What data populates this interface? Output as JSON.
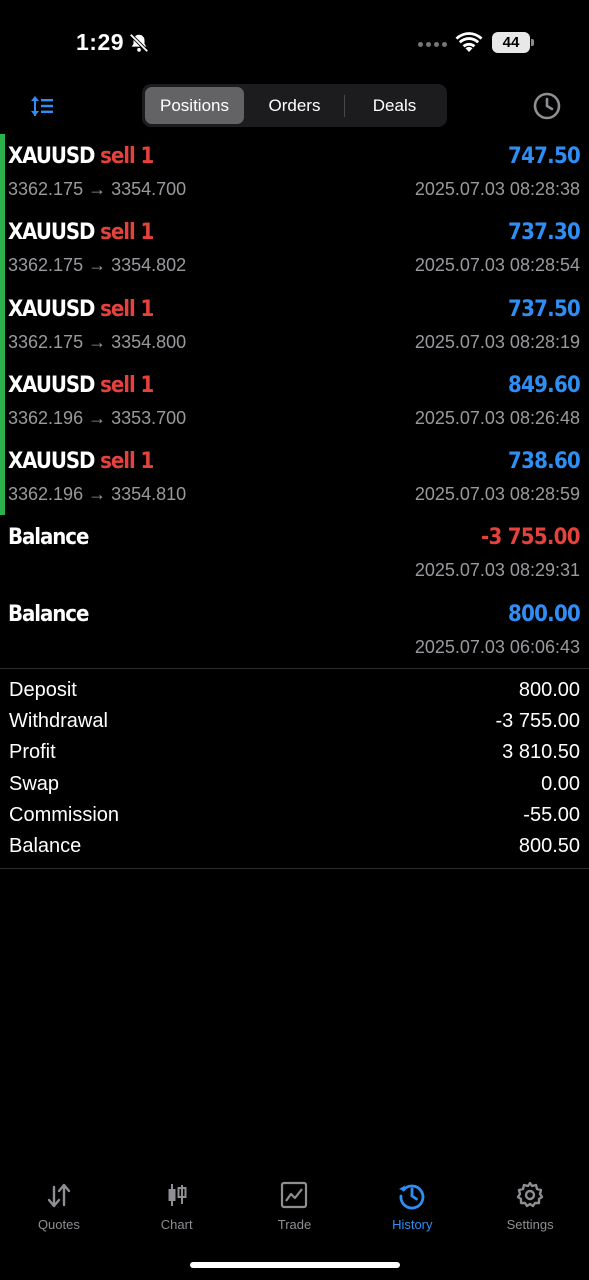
{
  "status": {
    "time": "1:29",
    "battery": "44"
  },
  "header": {
    "segments": [
      "Positions",
      "Orders",
      "Deals"
    ],
    "active_segment": "Positions"
  },
  "deals": [
    {
      "symbol": "XAUUSD",
      "side": "sell 1",
      "profit": "747.50",
      "open": "3362.175",
      "close": "3354.700",
      "time": "2025.07.03 08:28:38"
    },
    {
      "symbol": "XAUUSD",
      "side": "sell 1",
      "profit": "737.30",
      "open": "3362.175",
      "close": "3354.802",
      "time": "2025.07.03 08:28:54"
    },
    {
      "symbol": "XAUUSD",
      "side": "sell 1",
      "profit": "737.50",
      "open": "3362.175",
      "close": "3354.800",
      "time": "2025.07.03 08:28:19"
    },
    {
      "symbol": "XAUUSD",
      "side": "sell 1",
      "profit": "849.60",
      "open": "3362.196",
      "close": "3353.700",
      "time": "2025.07.03 08:26:48"
    },
    {
      "symbol": "XAUUSD",
      "side": "sell 1",
      "profit": "738.60",
      "open": "3362.196",
      "close": "3354.810",
      "time": "2025.07.03 08:28:59"
    }
  ],
  "balances": [
    {
      "label": "Balance",
      "amount": "-3 755.00",
      "time": "2025.07.03 08:29:31"
    },
    {
      "label": "Balance",
      "amount": "800.00",
      "time": "2025.07.03 06:06:43"
    }
  ],
  "summary": [
    {
      "label": "Deposit",
      "value": "800.00"
    },
    {
      "label": "Withdrawal",
      "value": "-3 755.00"
    },
    {
      "label": "Profit",
      "value": "3 810.50"
    },
    {
      "label": "Swap",
      "value": "0.00"
    },
    {
      "label": "Commission",
      "value": "-55.00"
    },
    {
      "label": "Balance",
      "value": "800.50"
    }
  ],
  "tabs": [
    {
      "label": "Quotes",
      "icon": "quotes-arrows-icon"
    },
    {
      "label": "Chart",
      "icon": "candlestick-icon"
    },
    {
      "label": "Trade",
      "icon": "trade-chart-icon"
    },
    {
      "label": "History",
      "icon": "history-icon"
    },
    {
      "label": "Settings",
      "icon": "gear-icon"
    }
  ],
  "active_tab": "History",
  "colors": {
    "positive": "#2f8ef4",
    "negative": "#e5423d",
    "accent_bar": "#2bb24c",
    "muted": "#9a9a9e"
  }
}
